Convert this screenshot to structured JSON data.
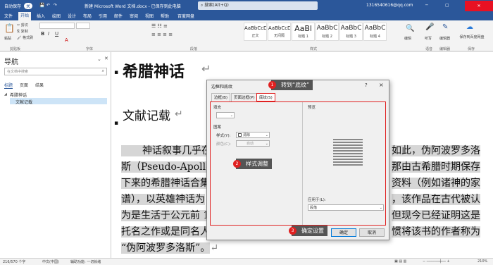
{
  "titlebar": {
    "autosave": "自动保存",
    "autosave_state": "关",
    "doc_title": "新建 Microsoft Word 文档.docx - 已保存到此电脑",
    "search_placeholder": "搜索(Alt+Q)",
    "account": "1316540616@qq.com"
  },
  "tabs": [
    "文件",
    "开始",
    "插入",
    "绘图",
    "设计",
    "布局",
    "引用",
    "邮件",
    "审阅",
    "视图",
    "帮助",
    "百度网盘"
  ],
  "ribbon": {
    "paste": "粘贴",
    "cut": "剪切",
    "copy": "复制",
    "format_painter": "格式刷",
    "clipboard_group": "剪贴板",
    "font_group": "字体",
    "paragraph_group": "段落",
    "styles_group": "样式",
    "styles": [
      {
        "preview": "AaBbCcDc",
        "name": "正文"
      },
      {
        "preview": "AaBbCcDc",
        "name": "无间隔"
      },
      {
        "preview": "AaBl",
        "name": "标题 1"
      },
      {
        "preview": "AaBbC",
        "name": "标题 2"
      },
      {
        "preview": "AaBbC",
        "name": "标题 3"
      },
      {
        "preview": "AaBbC",
        "name": "标题 4"
      }
    ],
    "edit": "编辑",
    "dictate": "听写",
    "editor": "编辑器",
    "save_baidu": "保存到百度网盘",
    "voice_group": "语音",
    "editor_group": "编辑器",
    "baidu_group": "保存"
  },
  "nav": {
    "title": "导航",
    "search_placeholder": "在文档中搜索",
    "tabs": [
      "标题",
      "页面",
      "结果"
    ],
    "tree": [
      "希腊神话",
      "文献记载"
    ]
  },
  "doc": {
    "heading1": "希腊神话",
    "heading2": "文献记载",
    "line1a": "神话叙事几乎在",
    "line1b": "如此，伪阿波罗多洛",
    "line2a": "斯（Pseudo-Apollod",
    "line2b": "那由古希腊时期保存",
    "line3a": "下来的希腊神话合集",
    "line3b": "资料（例如诸神的家",
    "line4a": "谱），以英雄神话为",
    "line4b": "，该作品在古代被认",
    "line5a": "为是生活于公元前 1",
    "line5b": "但现今已经证明这是",
    "line6a": "托名之作或是同名人",
    "line6b": "惯将该书的作者称为",
    "line7": "“伪阿波罗多洛斯”。",
    "para_mark": "↵"
  },
  "dialog": {
    "title": "边框和底纹",
    "help": "?",
    "close": "×",
    "tabs": [
      "边框(B)",
      "页面边框(P)",
      "底纹(S)"
    ],
    "fill_label": "填充",
    "pattern_label": "图案",
    "style_label": "样式(Y):",
    "style_value": "清除",
    "color_label": "颜色(C):",
    "color_value": "自动",
    "preview_label": "预览",
    "apply_label": "应用于(L):",
    "apply_value": "段落",
    "ok": "确定",
    "cancel": "取消"
  },
  "callouts": [
    {
      "num": "1",
      "text": "转到“底纹”"
    },
    {
      "num": "2",
      "text": "样式调整"
    },
    {
      "num": "3",
      "text": "确定设置"
    }
  ],
  "status": {
    "words": "216/570 个字",
    "lang": "中文(中国)",
    "accessibility": "辅助功能: 一切就绪",
    "zoom": "210%"
  },
  "colors": {
    "accent": "#2b579a",
    "callout_red": "#e02020",
    "callout_bg": "#555555"
  }
}
